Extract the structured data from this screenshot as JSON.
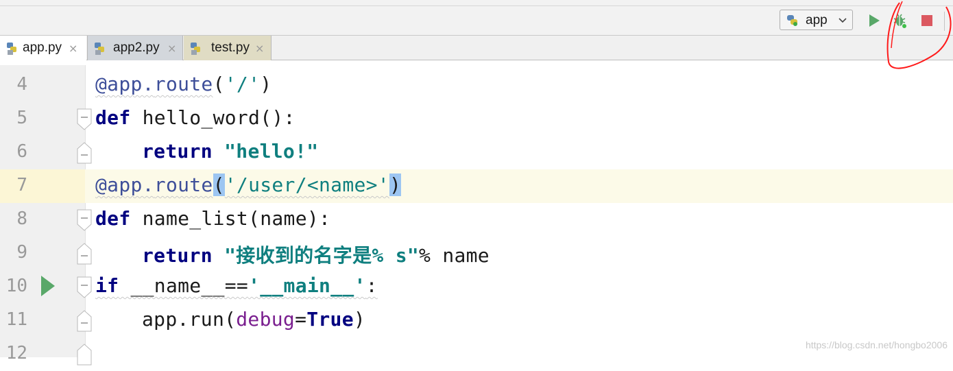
{
  "toolbar": {
    "run_config": "app",
    "buttons": [
      "run-icon",
      "debug-icon",
      "stop-icon"
    ],
    "colors": {
      "run": "#59a869",
      "stop": "#db5860",
      "annotation": "#ff0000"
    }
  },
  "tabs": [
    {
      "label": "app.py",
      "close": "×",
      "active": true
    },
    {
      "label": "app2.py",
      "close": "×",
      "active": false
    },
    {
      "label": "test.py",
      "close": "×",
      "active": false
    }
  ],
  "editor": {
    "current_line": "7",
    "lines": [
      {
        "num": "4",
        "t": {
          "a": "@app.",
          "b": "route",
          "c": "(",
          "d": "'/'",
          "e": ")"
        }
      },
      {
        "num": "5",
        "t": {
          "a": "def",
          "b": " hello_word():"
        }
      },
      {
        "num": "6",
        "t": {
          "a": "return",
          "b": " ",
          "c": "\"hello!\""
        }
      },
      {
        "num": "7",
        "t": {
          "a": "@app.",
          "b": "route",
          "c": "(",
          "d": "'/user/<name>'",
          "e": ")"
        }
      },
      {
        "num": "8",
        "t": {
          "a": "def",
          "b": " name_list(name):"
        }
      },
      {
        "num": "9",
        "t": {
          "a": "return",
          "b": " ",
          "c": "\"接收到的名字是% s\"",
          "d": "% name"
        }
      },
      {
        "num": "10",
        "t": {
          "a": "if",
          "b": " __name__==",
          "c": "'__main__'",
          "d": ":"
        }
      },
      {
        "num": "11",
        "t": {
          "a": "app.run(",
          "b": "debug",
          "c": "=",
          "d": "True",
          "e": ")"
        }
      },
      {
        "num": "12"
      }
    ]
  },
  "watermark": "https://blog.csdn.net/hongbo2006"
}
